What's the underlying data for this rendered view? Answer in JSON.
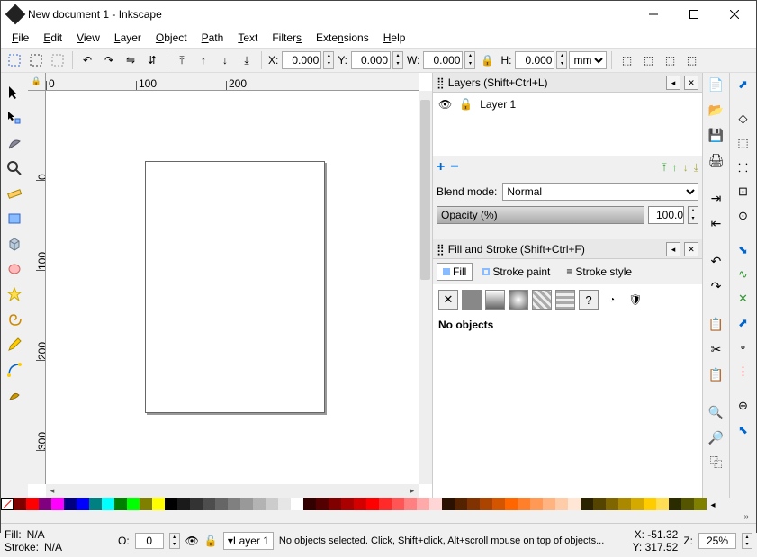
{
  "window": {
    "title": "New document 1 - Inkscape"
  },
  "menu": {
    "file": "File",
    "edit": "Edit",
    "view": "View",
    "layer": "Layer",
    "object": "Object",
    "path": "Path",
    "text": "Text",
    "filters": "Filters",
    "extensions": "Extensions",
    "help": "Help"
  },
  "coords_toolbar": {
    "x_label": "X:",
    "x": "0.000",
    "y_label": "Y:",
    "y": "0.000",
    "w_label": "W:",
    "w": "0.000",
    "h_label": "H:",
    "h": "0.000",
    "unit": "mm"
  },
  "ruler": {
    "h": [
      "0",
      "100",
      "200"
    ],
    "v": [
      "0",
      "100",
      "200",
      "300"
    ]
  },
  "layers_panel": {
    "title": "Layers (Shift+Ctrl+L)",
    "layer_name": "Layer 1",
    "blend_label": "Blend mode:",
    "blend_value": "Normal",
    "opacity_label": "Opacity (%)",
    "opacity_value": "100.0"
  },
  "fillstroke_panel": {
    "title": "Fill and Stroke (Shift+Ctrl+F)",
    "tab_fill": "Fill",
    "tab_strokepaint": "Stroke paint",
    "tab_strokestyle": "Stroke style",
    "msg": "No objects"
  },
  "palette": [
    "#000000",
    "#1a1a1a",
    "#333333",
    "#4d4d4d",
    "#666666",
    "#808080",
    "#999999",
    "#b3b3b3",
    "#cccccc",
    "#e6e6e6",
    "#ffffff",
    "#330000",
    "#550000",
    "#800000",
    "#aa0000",
    "#d40000",
    "#ff0000",
    "#ff2a2a",
    "#ff5555",
    "#ff8080",
    "#ffaaaa",
    "#ffd5d5",
    "#2b1100",
    "#552200",
    "#803300",
    "#aa4400",
    "#d45500",
    "#ff6600",
    "#ff7f2a",
    "#ff9955",
    "#ffb380",
    "#ffccaa",
    "#ffe6d5",
    "#2b2200",
    "#554400",
    "#806600",
    "#aa8800",
    "#d4aa00",
    "#ffcc00",
    "#ffdd55",
    "#2b2b00",
    "#555500",
    "#808000"
  ],
  "palette2": [
    "#800000",
    "#ff0000",
    "#800080",
    "#ff00ff",
    "#000080",
    "#0000ff",
    "#008080",
    "#00ffff",
    "#008000",
    "#00ff00",
    "#808000",
    "#ffff00"
  ],
  "status": {
    "fill_label": "Fill:",
    "fill_value": "N/A",
    "stroke_label": "Stroke:",
    "stroke_value": "N/A",
    "o_label": "O:",
    "o_value": "0",
    "layer": "Layer 1",
    "hint": "No objects selected. Click, Shift+click, Alt+scroll mouse on top of objects...",
    "x_label": "X:",
    "x": "-51.32",
    "y_label": "Y:",
    "y": "317.52",
    "z_label": "Z:",
    "zoom": "25%"
  }
}
